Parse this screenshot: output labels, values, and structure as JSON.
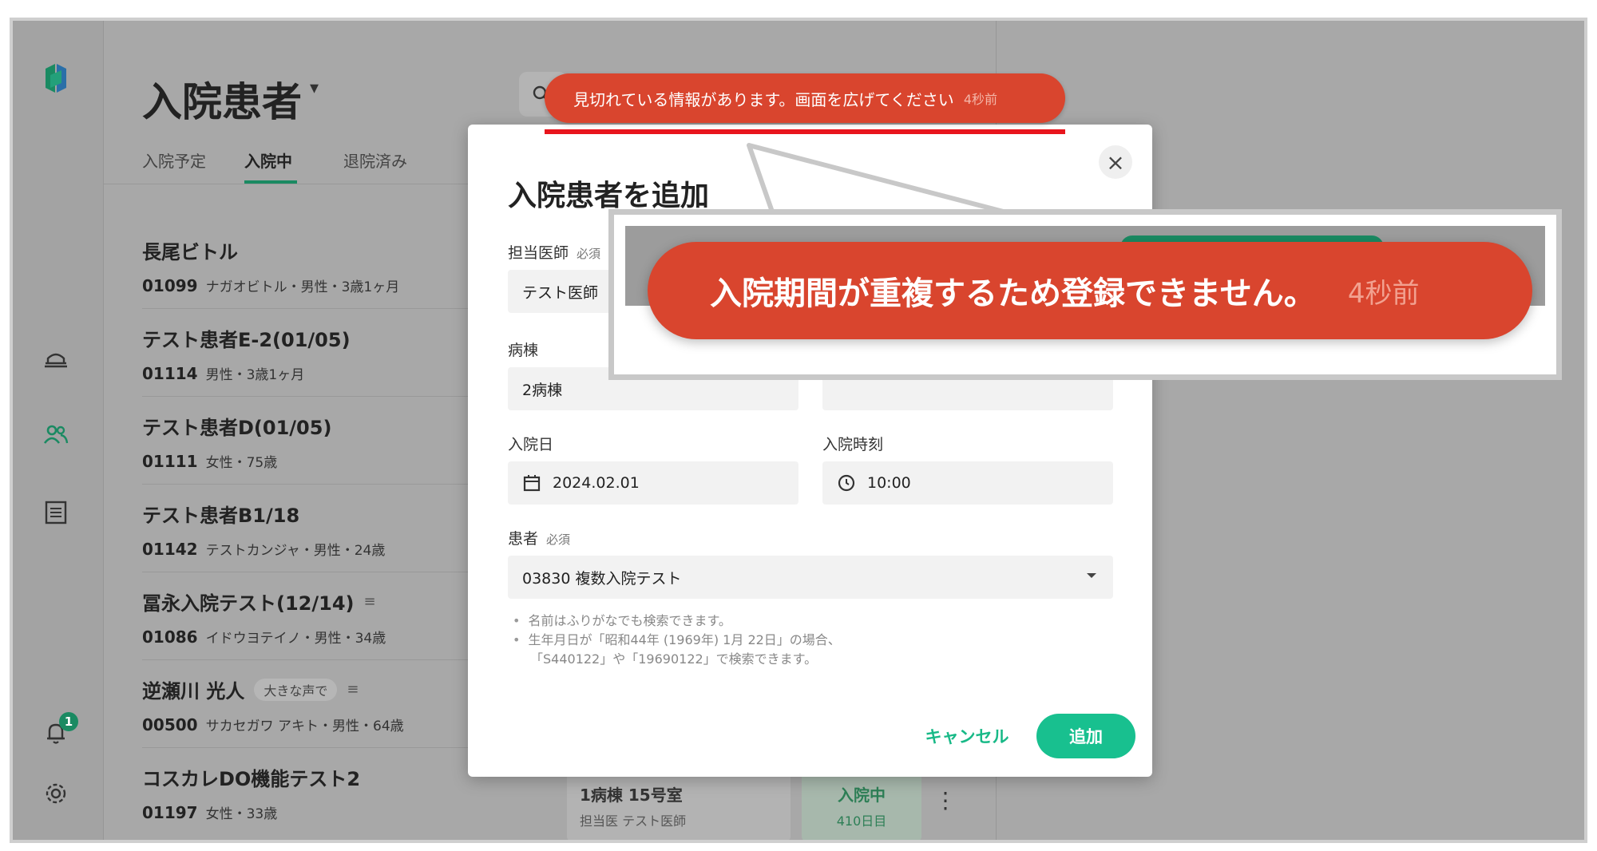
{
  "colors": {
    "accent": "#18c08f",
    "brand_green": "#1a8a62",
    "error_toast": "#d9452e",
    "highlight_underline": "#e8151d"
  },
  "header": {
    "title": "入院患者",
    "search_icon": "search-icon"
  },
  "tabs": [
    {
      "label": "入院予定"
    },
    {
      "label": "入院中"
    },
    {
      "label": "退院済み"
    }
  ],
  "patients": [
    {
      "name": "長尾ビトル",
      "id": "01099",
      "meta": "ナガオビトル・男性・3歳1ヶ月"
    },
    {
      "name": "テスト患者E-2(01/05)",
      "id": "01114",
      "meta": "男性・3歳1ヶ月"
    },
    {
      "name": "テスト患者D(01/05)",
      "id": "01111",
      "meta": "女性・75歳"
    },
    {
      "name": "テスト患者B1/18",
      "id": "01142",
      "meta": "テストカンジャ・男性・24歳"
    },
    {
      "name": "冨永入院テスト(12/14)",
      "id": "01086",
      "meta": "イドウヨテイノ・男性・34歳"
    },
    {
      "name": "逆瀬川 光人",
      "tag": "大きな声で",
      "id": "00500",
      "meta": "サカセガワ アキト・男性・64歳"
    },
    {
      "name": "コスカレDO機能テスト2",
      "id": "01197",
      "meta": "女性・33歳"
    }
  ],
  "room_card": {
    "title": "1病棟 15号室",
    "doctor": "担当医 テスト医師"
  },
  "status_card": {
    "label": "入院中",
    "days": "410日目"
  },
  "notifications": {
    "badge": "1"
  },
  "modal": {
    "title": "入院患者を追加",
    "close": "×",
    "doctor_label": "担当医師",
    "doctor_required": "必須",
    "doctor_value": "テスト医師",
    "ward_label": "病棟",
    "ward_value": "2病棟",
    "admit_date_label": "入院日",
    "admit_date_value": "2024.02.01",
    "admit_time_label": "入院時刻",
    "admit_time_value": "10:00",
    "patient_label": "患者",
    "patient_required": "必須",
    "patient_value": "03830 複数入院テスト",
    "hint_1": "名前はふりがなでも検索できます。",
    "hint_2a": "生年月日が「昭和44年 (1969年) 1月 22日」の場合、",
    "hint_2b": "「S440122」や「19690122」で検索できます。",
    "cancel": "キャンセル",
    "add": "追加"
  },
  "toast_small": {
    "message": "見切れている情報があります。画面を広げてください",
    "time": "4秒前"
  },
  "toast_large": {
    "message": "入院期間が重複するため登録できません。",
    "time": "4秒前"
  }
}
